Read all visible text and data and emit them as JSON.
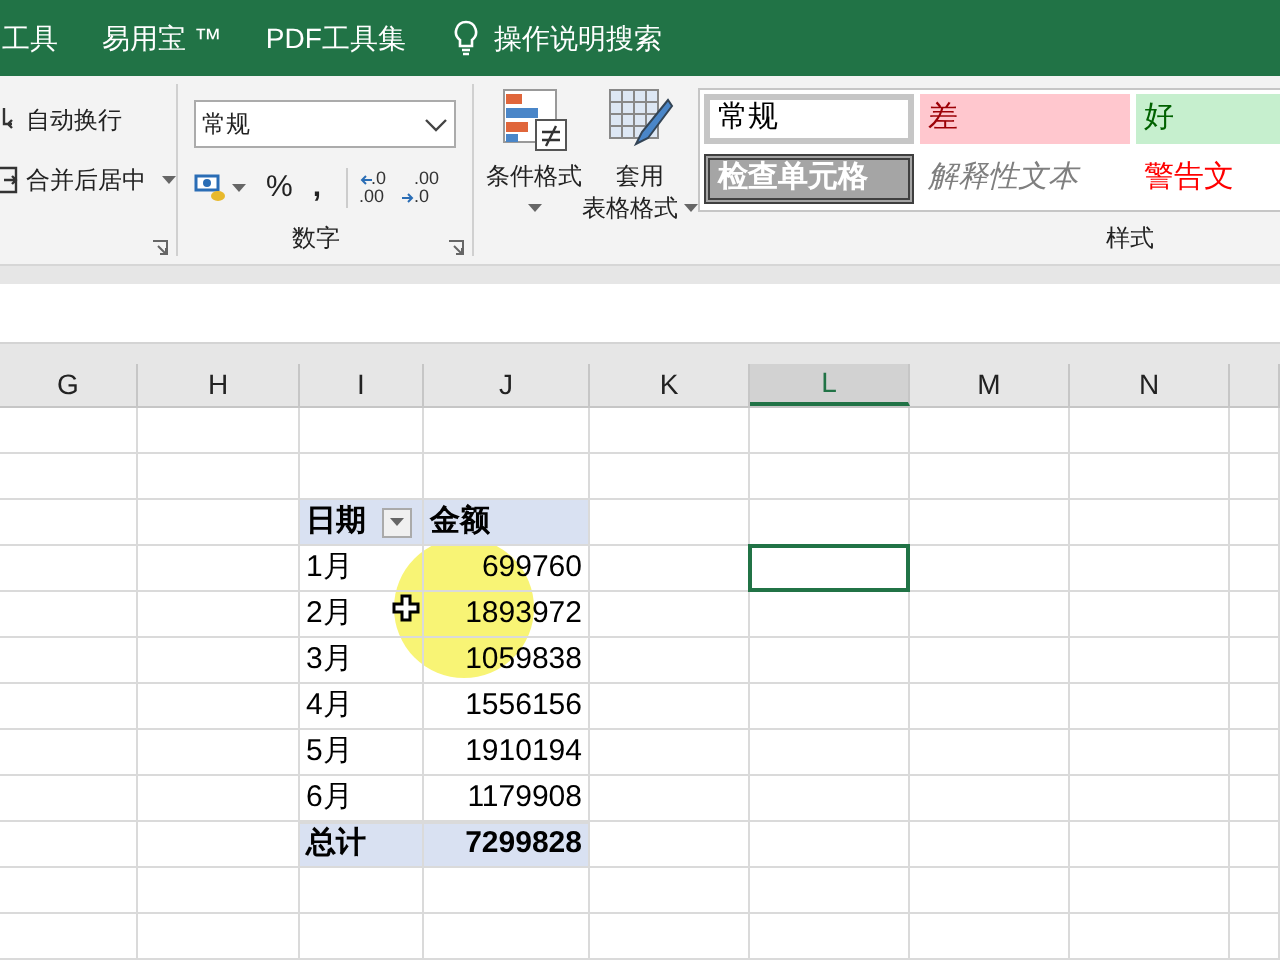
{
  "ribbon_tabs": [
    {
      "label": "工具"
    },
    {
      "label": "易用宝 ™"
    },
    {
      "label": "PDF工具集"
    }
  ],
  "tell_me": {
    "placeholder": "操作说明搜索"
  },
  "alignment_group": {
    "buttons": [
      {
        "label": "自动换行",
        "kind": "wrap"
      },
      {
        "label": "合并后居中",
        "kind": "merge"
      }
    ]
  },
  "number_group": {
    "label": "数字",
    "format": "常规",
    "percent": "%",
    "comma": ",",
    "increase_decimal": [
      ".0",
      ".00"
    ],
    "decrease_decimal": [
      ".00",
      ".0"
    ]
  },
  "style_buttons": [
    {
      "lines": [
        "条件格式"
      ],
      "kind": "conditional"
    },
    {
      "lines": [
        "套用",
        "表格格式"
      ],
      "kind": "table"
    }
  ],
  "cell_styles": {
    "label": "样式",
    "items": [
      {
        "label": "常规",
        "kind": "normal"
      },
      {
        "label": "差",
        "kind": "bad"
      },
      {
        "label": "好",
        "kind": "good"
      },
      {
        "label": "检查单元格",
        "kind": "check"
      },
      {
        "label": "解释性文本",
        "kind": "explanatory"
      },
      {
        "label": "警告文",
        "kind": "warning"
      }
    ]
  },
  "columns": [
    {
      "label": "G",
      "selected": false
    },
    {
      "label": "H",
      "selected": false
    },
    {
      "label": "I",
      "selected": false
    },
    {
      "label": "J",
      "selected": false
    },
    {
      "label": "K",
      "selected": false
    },
    {
      "label": "L",
      "selected": true
    },
    {
      "label": "M",
      "selected": false
    },
    {
      "label": "N",
      "selected": false
    }
  ],
  "pivot": {
    "headers": [
      "日期",
      "金额"
    ],
    "rows": [
      {
        "month": "1月",
        "amount": "699760"
      },
      {
        "month": "2月",
        "amount": "1893972"
      },
      {
        "month": "3月",
        "amount": "1059838"
      },
      {
        "month": "4月",
        "amount": "1556156"
      },
      {
        "month": "5月",
        "amount": "1910194"
      },
      {
        "month": "6月",
        "amount": "1179908"
      }
    ],
    "total": {
      "label": "总计",
      "amount": "7299828"
    }
  }
}
